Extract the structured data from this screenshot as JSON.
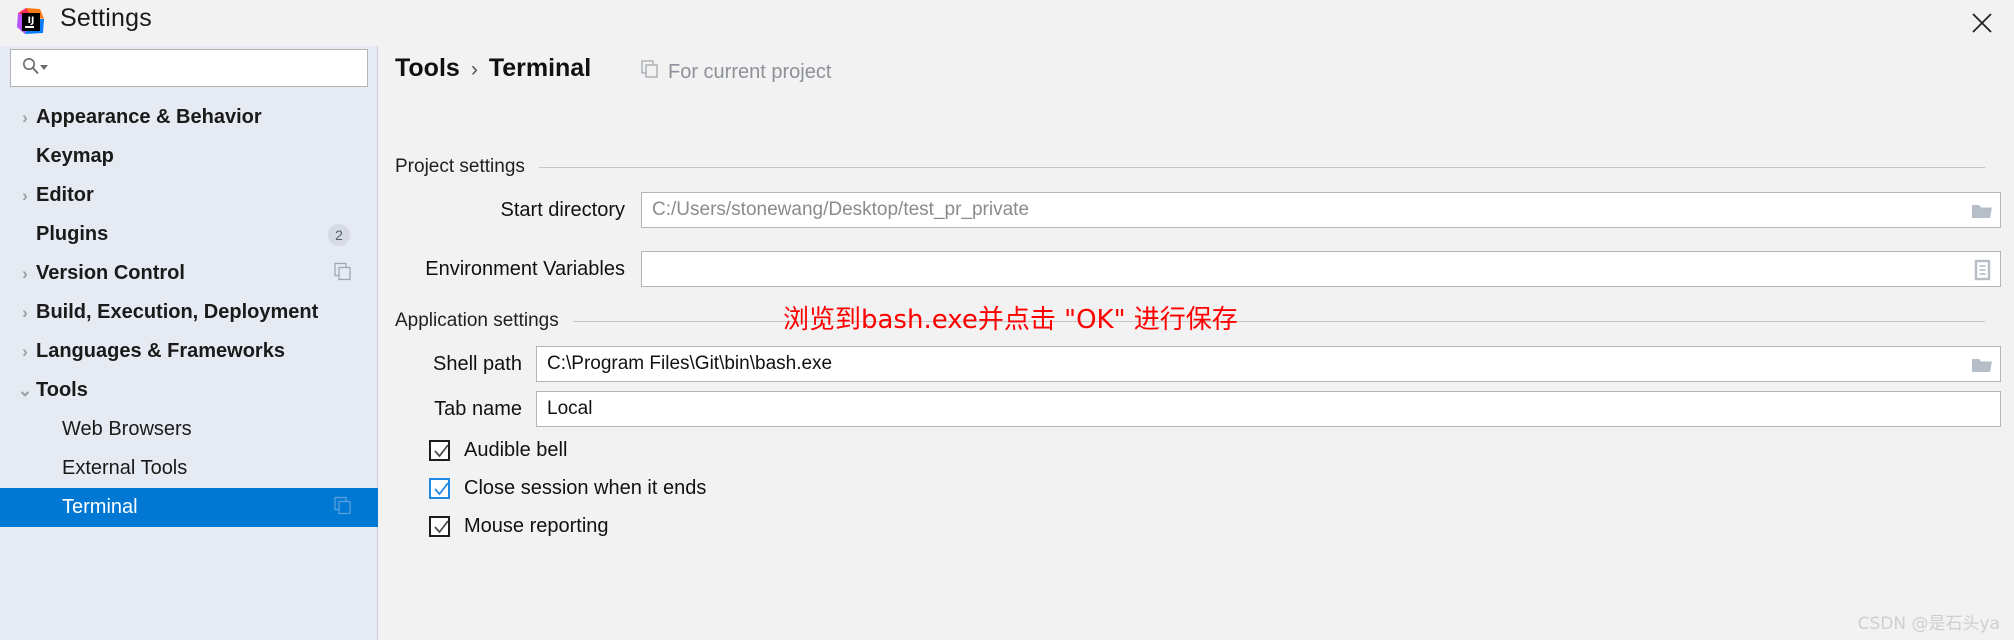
{
  "window": {
    "title": "Settings",
    "logo_icon": "intellij-idea-logo-icon",
    "close_icon": "close-icon"
  },
  "sidebar": {
    "search": {
      "placeholder": "",
      "value": "",
      "icon": "search-icon",
      "dropdown_icon": "chevron-down-icon"
    },
    "items": [
      {
        "label": "Appearance & Behavior",
        "arrow": "›",
        "bold": true,
        "child": false,
        "selected": false,
        "badge": null,
        "icon": null
      },
      {
        "label": "Keymap",
        "arrow": "",
        "bold": true,
        "child": false,
        "selected": false,
        "badge": null,
        "icon": null
      },
      {
        "label": "Editor",
        "arrow": "›",
        "bold": true,
        "child": false,
        "selected": false,
        "badge": null,
        "icon": null
      },
      {
        "label": "Plugins",
        "arrow": "",
        "bold": true,
        "child": false,
        "selected": false,
        "badge": "2",
        "icon": null
      },
      {
        "label": "Version Control",
        "arrow": "›",
        "bold": true,
        "child": false,
        "selected": false,
        "badge": null,
        "icon": "copy-icon"
      },
      {
        "label": "Build, Execution, Deployment",
        "arrow": "›",
        "bold": true,
        "child": false,
        "selected": false,
        "badge": null,
        "icon": null
      },
      {
        "label": "Languages & Frameworks",
        "arrow": "›",
        "bold": true,
        "child": false,
        "selected": false,
        "badge": null,
        "icon": null
      },
      {
        "label": "Tools",
        "arrow": "⌄",
        "bold": true,
        "child": false,
        "selected": false,
        "badge": null,
        "icon": null
      },
      {
        "label": "Web Browsers",
        "arrow": "",
        "bold": false,
        "child": true,
        "selected": false,
        "badge": null,
        "icon": null
      },
      {
        "label": "External Tools",
        "arrow": "",
        "bold": false,
        "child": true,
        "selected": false,
        "badge": null,
        "icon": null
      },
      {
        "label": "Terminal",
        "arrow": "",
        "bold": false,
        "child": true,
        "selected": true,
        "badge": null,
        "icon": "copy-icon"
      }
    ]
  },
  "content": {
    "breadcrumb": {
      "parent": "Tools",
      "separator": "›",
      "current": "Terminal"
    },
    "for_project": {
      "label": "For current project",
      "icon": "project-scope-icon"
    },
    "project_settings": {
      "section_title": "Project settings",
      "start_directory": {
        "label": "Start directory",
        "value": "C:/Users/stonewang/Desktop/test_pr_private",
        "is_placeholder": true,
        "browse_icon": "folder-icon"
      },
      "environment_variables": {
        "label": "Environment Variables",
        "value": "",
        "browse_icon": "list-edit-icon"
      }
    },
    "application_settings": {
      "section_title": "Application settings",
      "shell_path": {
        "label": "Shell path",
        "value": "C:\\Program Files\\Git\\bin\\bash.exe",
        "browse_icon": "folder-icon"
      },
      "tab_name": {
        "label": "Tab name",
        "value": "Local"
      },
      "checkboxes": [
        {
          "label": "Audible bell",
          "checked": true,
          "focused": false
        },
        {
          "label": "Close session when it ends",
          "checked": true,
          "focused": true
        },
        {
          "label": "Mouse reporting",
          "checked": true,
          "focused": false
        }
      ]
    },
    "annotation": "浏览到bash.exe并点击 \"OK\" 进行保存"
  },
  "watermark": "CSDN @是石头ya",
  "colors": {
    "accent": "#0078d4",
    "sidebar_bg": "#e6eaf2",
    "annotation_red": "#ff0000"
  }
}
